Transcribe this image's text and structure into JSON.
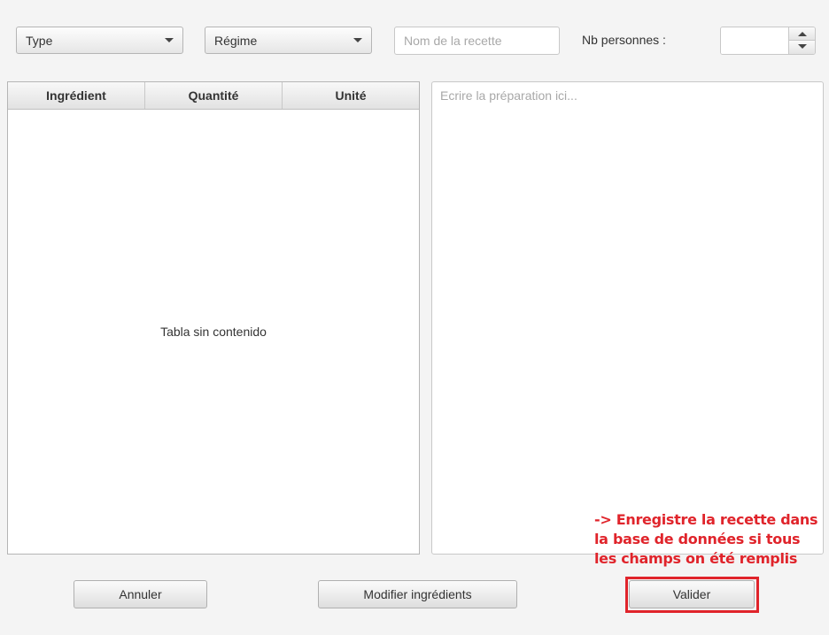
{
  "filters": {
    "type_label": "Type",
    "regime_label": "Régime",
    "recipe_name_placeholder": "Nom de la recette",
    "persons_label": "Nb personnes :",
    "persons_value": ""
  },
  "table": {
    "columns": [
      "Ingrédient",
      "Quantité",
      "Unité"
    ],
    "empty_message": "Tabla sin contenido"
  },
  "preparation": {
    "placeholder": "Ecrire la préparation ici..."
  },
  "annotation": {
    "text": "-> Enregistre la recette dans la base de données si tous les champs on été remplis",
    "color": "#e0242b"
  },
  "buttons": {
    "cancel": "Annuler",
    "edit_ingredients": "Modifier ingrédients",
    "validate": "Valider"
  }
}
